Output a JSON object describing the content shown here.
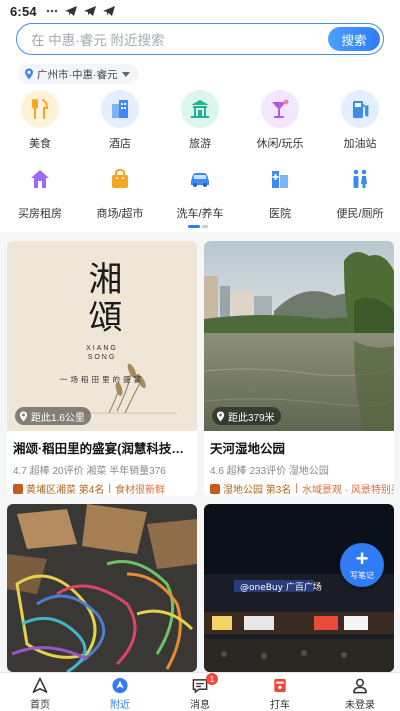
{
  "status_bar": {
    "time": "6:54"
  },
  "search": {
    "placeholder": "在 中惠·睿元 附近搜索",
    "button_label": "搜索"
  },
  "location": {
    "label": "广州市·中惠·睿元"
  },
  "categories_row1": [
    {
      "label": "美食",
      "icon": "food-icon",
      "bg": "#fff2d9",
      "color": "#f5a623"
    },
    {
      "label": "酒店",
      "icon": "hotel-icon",
      "bg": "#e3efff",
      "color": "#3d8bf2"
    },
    {
      "label": "旅游",
      "icon": "travel-icon",
      "bg": "#dcf6ee",
      "color": "#1fb58c"
    },
    {
      "label": "休闲/玩乐",
      "icon": "leisure-icon",
      "bg": "#f3e6ff",
      "color": "#b05ce8"
    },
    {
      "label": "加油站",
      "icon": "gas-station-icon",
      "bg": "#e3efff",
      "color": "#3d8bf2"
    }
  ],
  "categories_row2": [
    {
      "label": "买房租房",
      "icon": "house-icon",
      "color": "#9b6cf0"
    },
    {
      "label": "商场/超市",
      "icon": "shopping-bag-icon",
      "color": "#f5a623"
    },
    {
      "label": "洗车/养车",
      "icon": "car-icon",
      "color": "#3d8bf2"
    },
    {
      "label": "医院",
      "icon": "hospital-icon",
      "color": "#3d8bf2"
    },
    {
      "label": "便民/厕所",
      "icon": "toilet-icon",
      "color": "#3d8bf2"
    }
  ],
  "cards": [
    {
      "distance": "距此1.6公里",
      "title": "湘颂·稻田里的盛宴(润慧科技园店)",
      "meta": "4.7 超棒  20评价  湘菜  半年销量376",
      "rank": "黄埔区湘菜 第4名",
      "extra": "食材很新鲜",
      "poster_title": "湘頌",
      "poster_sub1": "XIANG",
      "poster_sub2": "SONG",
      "poster_tagline": "一场稻田里的盛宴"
    },
    {
      "distance": "距此379米",
      "title": "天河湿地公园",
      "meta": "4.6 超棒  233评价  湿地公园",
      "rank": "湿地公园 第3名",
      "extra": "水域景观 · 风景特别美"
    }
  ],
  "fab": {
    "label": "写笔记"
  },
  "bottom_nav": [
    {
      "label": "首页",
      "icon": "home-arrow-icon"
    },
    {
      "label": "附近",
      "icon": "nearby-pin-icon",
      "active": true
    },
    {
      "label": "消息",
      "icon": "message-icon",
      "badge": "1"
    },
    {
      "label": "打车",
      "icon": "taxi-icon"
    },
    {
      "label": "未登录",
      "icon": "user-icon"
    }
  ],
  "colors": {
    "accent": "#2f7cf5",
    "badge_red": "#f0483e",
    "rank_brown": "#c55b20"
  }
}
